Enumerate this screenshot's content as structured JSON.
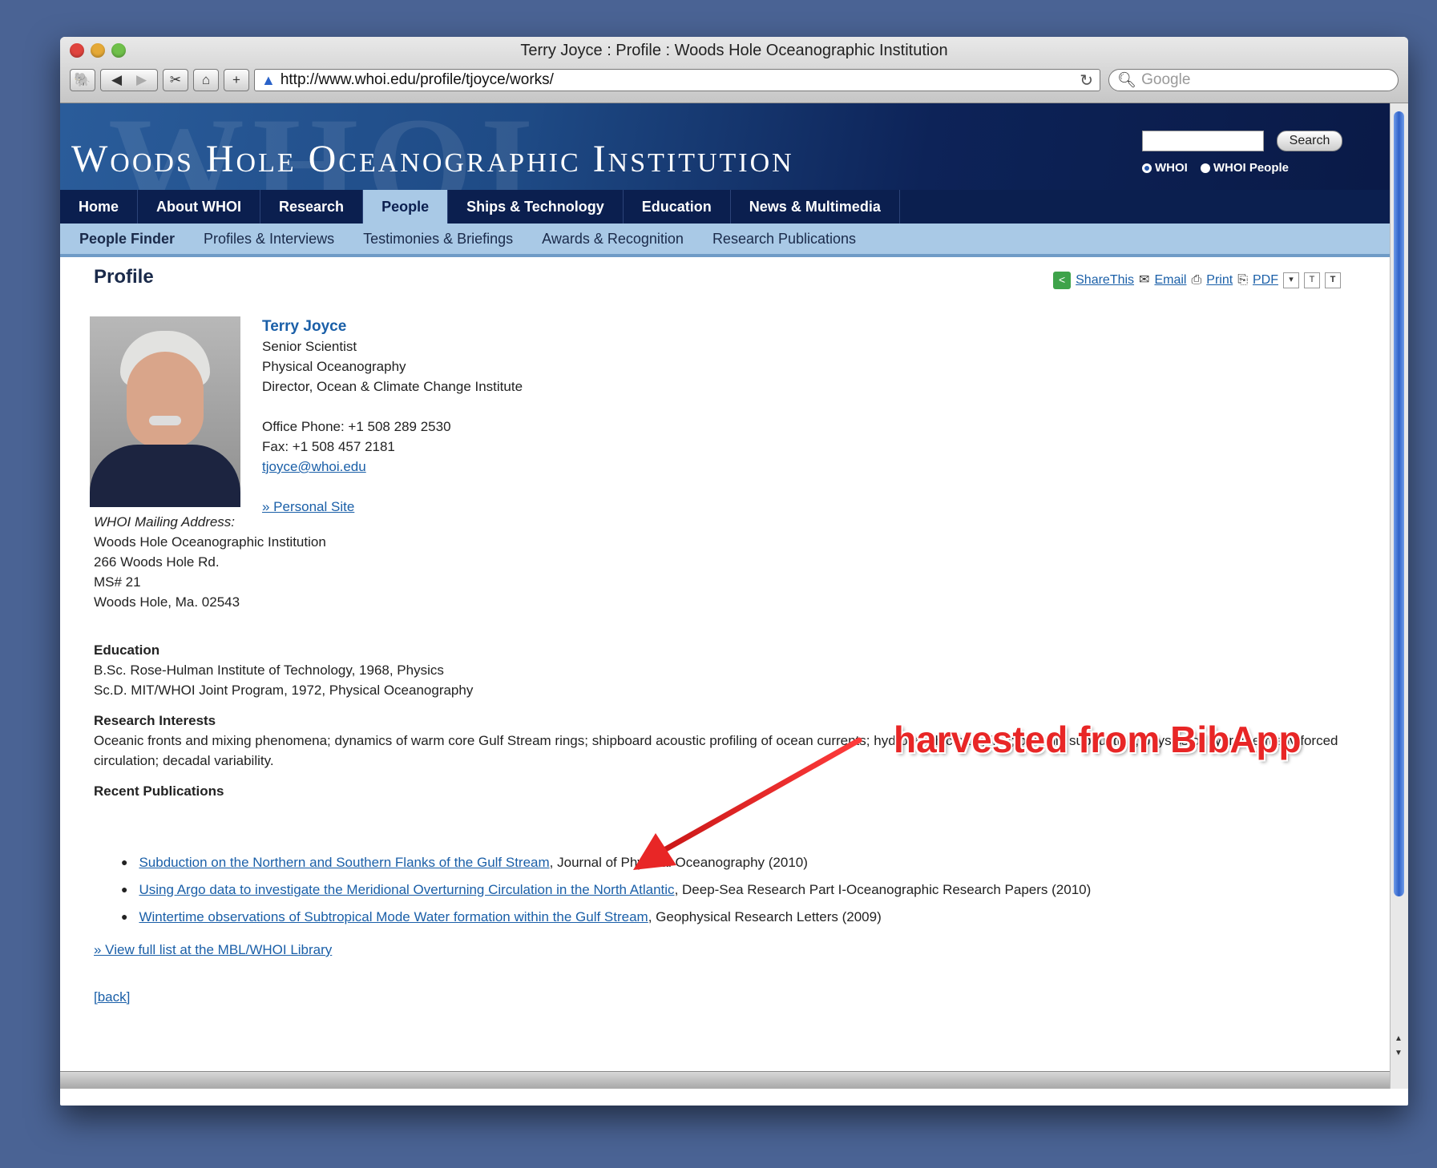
{
  "window": {
    "title": "Terry Joyce : Profile : Woods Hole Oceanographic Institution"
  },
  "toolbar": {
    "url": "http://www.whoi.edu/profile/tjoyce/works/",
    "search_placeholder": "Google"
  },
  "site": {
    "brand": "Woods Hole Oceanographic Institution",
    "search_button": "Search",
    "radio_options": [
      "WHOI",
      "WHOI People"
    ]
  },
  "nav": {
    "main": [
      "Home",
      "About WHOI",
      "Research",
      "People",
      "Ships & Technology",
      "Education",
      "News & Multimedia"
    ],
    "sub": [
      "People Finder",
      "Profiles & Interviews",
      "Testimonies & Briefings",
      "Awards & Recognition",
      "Research Publications"
    ]
  },
  "profile": {
    "heading": "Profile",
    "tools": {
      "share": "ShareThis",
      "email": "Email",
      "print": "Print",
      "pdf": "PDF"
    },
    "name": "Terry Joyce",
    "title": "Senior Scientist",
    "department": "Physical Oceanography",
    "role": "Director, Ocean & Climate Change Institute",
    "phone": "Office Phone: +1 508 289 2530",
    "fax": "Fax: +1 508 457 2181",
    "email": "tjoyce@whoi.edu",
    "personal_site": "» Personal Site",
    "mailing": {
      "label": "WHOI Mailing Address:",
      "lines": [
        "Woods Hole Oceanographic Institution",
        "266 Woods Hole Rd.",
        "MS# 21",
        "Woods Hole, Ma. 02543"
      ]
    },
    "education": {
      "heading": "Education",
      "lines": [
        "B.Sc. Rose-Hulman Institute of Technology, 1968, Physics",
        "Sc.D. MIT/WHOI Joint Program, 1972, Physical Oceanography"
      ]
    },
    "research": {
      "heading": "Research Interests",
      "text": "Oceanic fronts and mixing phenomena; dynamics of warm core Gulf Stream rings; shipboard acoustic profiling of ocean currents; hydrographic sampling; oceanic subduction; physics of hydrothermally forced circulation; decadal variability."
    },
    "publications": {
      "heading": "Recent Publications",
      "items": [
        {
          "title": "Subduction on the Northern and Southern Flanks of the Gulf Stream",
          "rest": ", Journal of Physical Oceanography (2010)"
        },
        {
          "title": "Using Argo data to investigate the Meridional Overturning Circulation in the North Atlantic",
          "rest": ", Deep-Sea Research Part I-Oceanographic Research Papers (2010)"
        },
        {
          "title": "Wintertime observations of Subtropical Mode Water formation within the Gulf Stream",
          "rest": ", Geophysical Research Letters (2009)"
        }
      ],
      "view_full": "» View full list at the MBL/WHOI Library"
    },
    "back": "[back]"
  },
  "annotation": "harvested from BibApp",
  "colors": {
    "annotation": "#e82626",
    "nav_dark": "#0b1f4f",
    "nav_light": "#a9c9e6",
    "link": "#1a5fa8"
  }
}
